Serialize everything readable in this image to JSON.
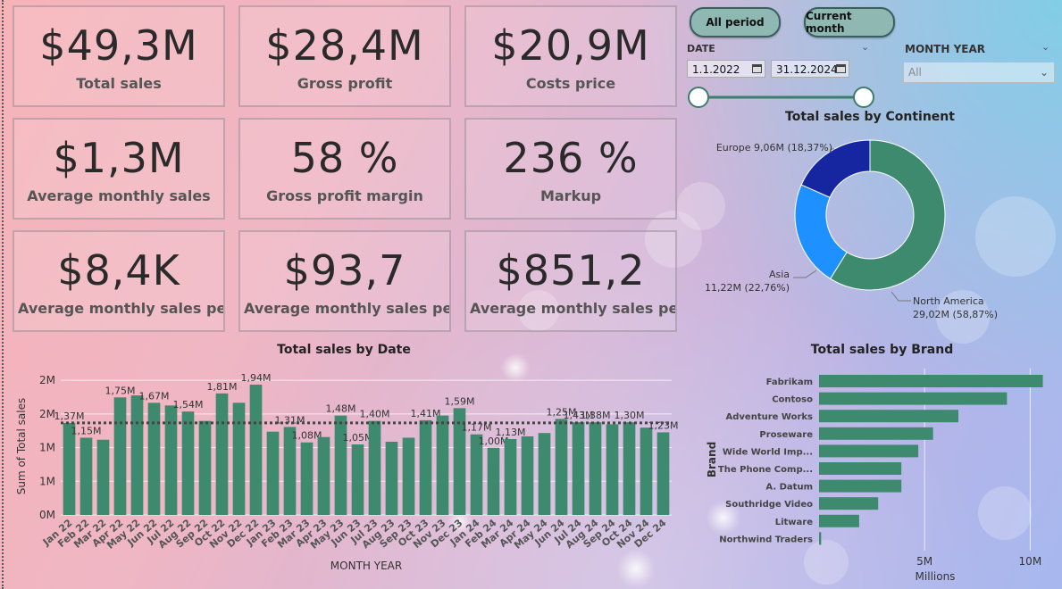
{
  "kpis": [
    {
      "value": "$49,3M",
      "label": "Total sales"
    },
    {
      "value": "$28,4M",
      "label": "Gross profit"
    },
    {
      "value": "$20,9M",
      "label": "Costs price"
    },
    {
      "value": "$1,3M",
      "label": "Average monthly sales"
    },
    {
      "value": "58 %",
      "label": "Gross profit margin"
    },
    {
      "value": "236 %",
      "label": "Markup"
    },
    {
      "value": "$8,4K",
      "label": "Average monthly sales pe..."
    },
    {
      "value": "$93,7",
      "label": "Average monthly sales pe..."
    },
    {
      "value": "$851,2",
      "label": "Average monthly sales pe..."
    }
  ],
  "buttons": {
    "all_period": "All period",
    "current_month": "Current month"
  },
  "date_slicer": {
    "title": "DATE",
    "start": "1.1.2022",
    "end": "31.12.2024",
    "range": [
      0,
      1
    ]
  },
  "month_slicer": {
    "title": "MONTH YEAR",
    "value": "All"
  },
  "colors": {
    "bar": "#3d8a6e",
    "asia": "#1e90ff",
    "europe": "#1626a0",
    "na": "#3d8a6e"
  },
  "chart_data": [
    {
      "type": "pie",
      "title": "Total sales by Continent",
      "slices": [
        {
          "name": "North America",
          "value": 29.02,
          "label1": "North America",
          "label2": "29,02M (58,87%)"
        },
        {
          "name": "Asia",
          "value": 11.22,
          "label1": "Asia",
          "label2": "11,22M (22,76%)"
        },
        {
          "name": "Europe",
          "value": 9.06,
          "label1": "Europe 9,06M (18,37%)",
          "label2": ""
        }
      ]
    },
    {
      "type": "bar",
      "title": "Total sales by Date",
      "xlabel": "MONTH YEAR",
      "ylabel": "Sum of Total sales",
      "yticks": [
        "0M",
        "1M",
        "1M",
        "2M",
        "2M"
      ],
      "ylim": [
        0,
        2.1
      ],
      "average": 1.37,
      "categories": [
        "Jan 22",
        "Feb 22",
        "Mar 22",
        "Apr 22",
        "May 22",
        "Jun 22",
        "Jul 22",
        "Aug 22",
        "Sep 22",
        "Oct 22",
        "Nov 22",
        "Dec 22",
        "Jan 23",
        "Feb 23",
        "Mar 23",
        "Apr 23",
        "May 23",
        "Jun 23",
        "Jul 23",
        "Aug 23",
        "Sep 23",
        "Oct 23",
        "Nov 23",
        "Dec 23",
        "Jan 24",
        "Feb 24",
        "Mar 24",
        "Apr 24",
        "May 24",
        "Jun 24",
        "Jul 24",
        "Aug 24",
        "Sep 24",
        "Oct 24",
        "Nov 24",
        "Dec 24"
      ],
      "values": [
        1.37,
        1.15,
        1.12,
        1.75,
        1.78,
        1.67,
        1.63,
        1.54,
        1.4,
        1.81,
        1.67,
        1.94,
        1.24,
        1.31,
        1.08,
        1.16,
        1.48,
        1.05,
        1.4,
        1.09,
        1.15,
        1.41,
        1.48,
        1.59,
        1.2,
        1.0,
        1.13,
        1.17,
        1.22,
        1.43,
        1.38,
        1.38,
        1.35,
        1.38,
        1.3,
        1.23
      ],
      "data_labels": [
        "1,37M",
        "1,15M",
        "",
        "1,75M",
        "",
        "1,67M",
        "",
        "1,54M",
        "",
        "1,81M",
        "",
        "1,94M",
        "",
        "1,31M",
        "1,08M",
        "",
        "1,48M",
        "1,05M",
        "1,40M",
        "",
        "",
        "1,41M",
        "",
        "1,59M",
        "1,17M",
        "1,00M",
        "1,13M",
        "",
        "",
        "1,25M",
        "1,43M",
        "1,38M",
        "",
        "1,30M",
        "",
        "1,23M"
      ]
    },
    {
      "type": "bar",
      "orientation": "horizontal",
      "title": "Total sales by Brand",
      "ylabel": "Brand",
      "xlabel": "Millions",
      "xticks": [
        "5M",
        "10M"
      ],
      "xlim": [
        0,
        11
      ],
      "categories": [
        "Fabrikam",
        "Contoso",
        "Adventure Works",
        "Proseware",
        "Wide World Imp...",
        "The Phone Comp...",
        "A. Datum",
        "Southridge Video",
        "Litware",
        "Northwind Traders"
      ],
      "values": [
        10.6,
        8.9,
        6.6,
        5.4,
        4.7,
        3.9,
        3.9,
        2.8,
        1.9,
        0.1
      ]
    }
  ]
}
